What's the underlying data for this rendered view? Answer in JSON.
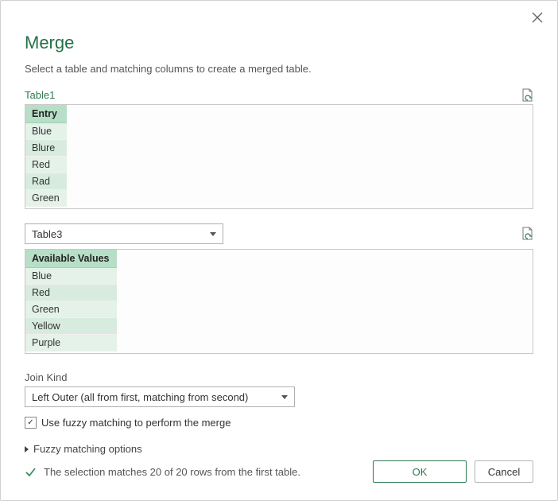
{
  "title": "Merge",
  "subtitle": "Select a table and matching columns to create a merged table.",
  "table1": {
    "label": "Table1",
    "column_header": "Entry",
    "rows": [
      "Blue",
      "Blure",
      "Red",
      "Rad",
      "Green"
    ]
  },
  "table2": {
    "selected": "Table3",
    "column_header": "Available Values",
    "rows": [
      "Blue",
      "Red",
      "Green",
      "Yellow",
      "Purple"
    ]
  },
  "join_kind": {
    "label": "Join Kind",
    "selected": "Left Outer (all from first, matching from second)"
  },
  "fuzzy_checkbox": {
    "checked": true,
    "label": "Use fuzzy matching to perform the merge"
  },
  "fuzzy_options_label": "Fuzzy matching options",
  "status": "The selection matches 20 of 20 rows from the first table.",
  "buttons": {
    "ok": "OK",
    "cancel": "Cancel"
  }
}
